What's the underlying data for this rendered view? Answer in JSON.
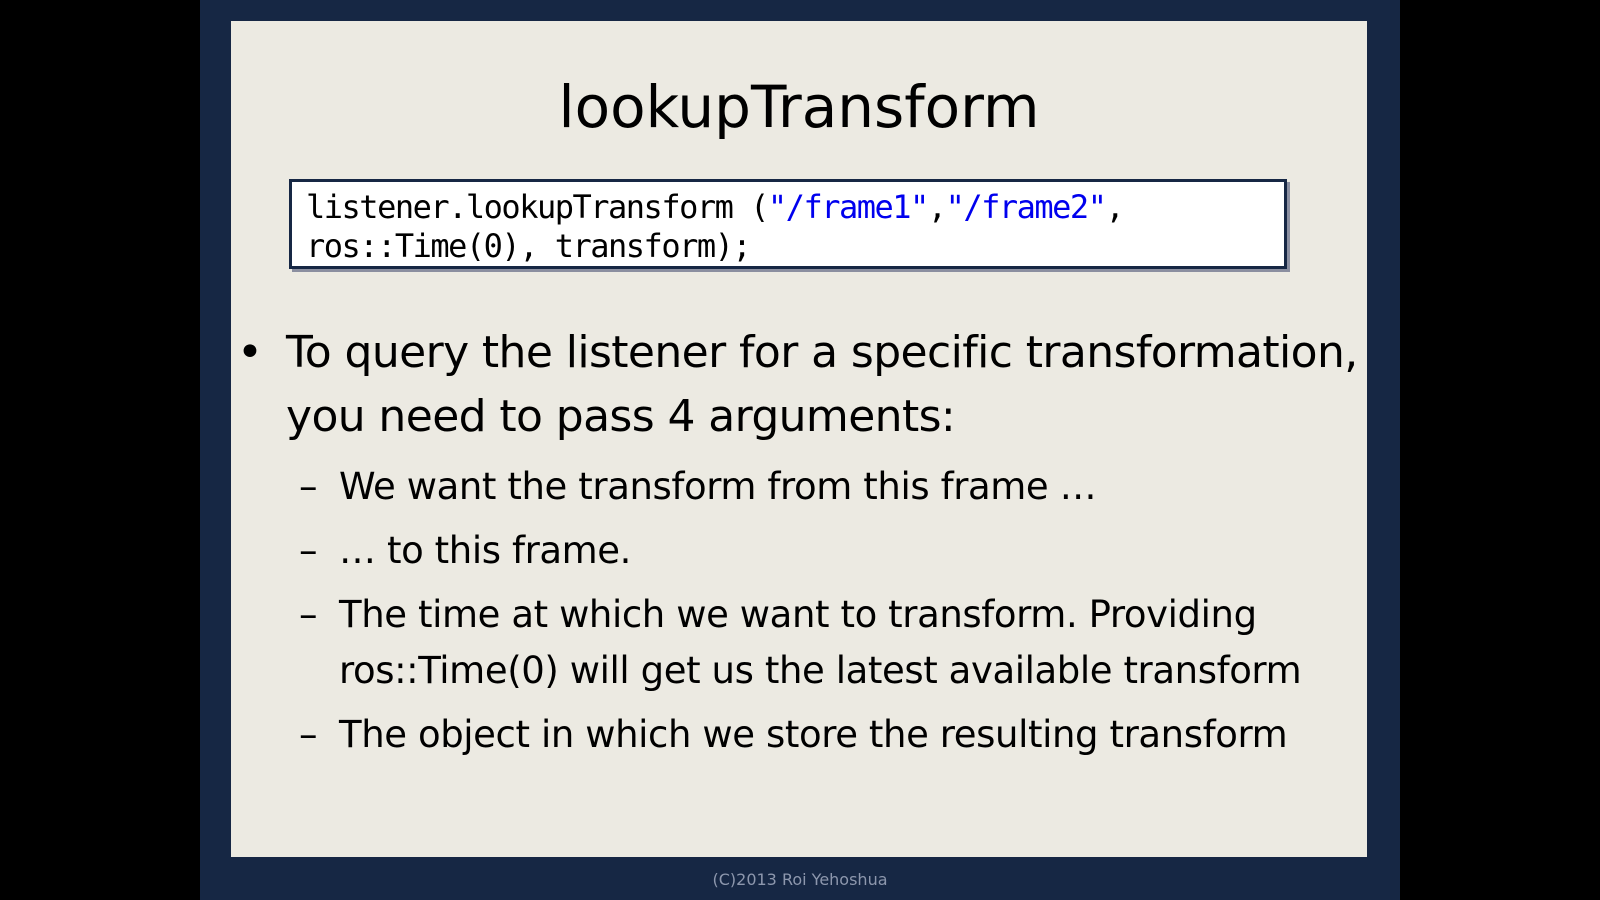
{
  "slide": {
    "title": "lookupTransform",
    "code": {
      "line1_a": "listener.lookupTransform (",
      "line1_s1": "\"/frame1\"",
      "line1_sep": ",",
      "line1_s2": "\"/frame2\"",
      "line1_end": ",",
      "line2": "ros::Time(0), transform);"
    },
    "bullet": {
      "text": "To query the listener for a specific transformation, you need to pass 4 arguments:",
      "mark": "•"
    },
    "sub_mark": "–",
    "subs": [
      "We want the transform from this frame …",
      "… to this frame.",
      "The time at which we want to transform. Providing ros::Time(0) will get us the latest available transform",
      "The object in which we store the resulting transform"
    ]
  },
  "footer": "(C)2013 Roi Yehoshua",
  "colors": {
    "frame": "#162744",
    "slide_bg": "#ECEAE2",
    "code_string": "#0000EE",
    "footer_text": "#8D97AD"
  }
}
